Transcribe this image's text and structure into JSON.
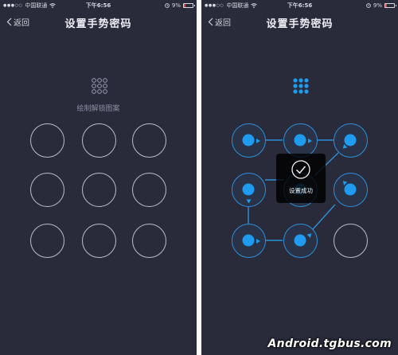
{
  "status_bar": {
    "carrier": "中国联通",
    "time": "下午6:56",
    "battery": "9%"
  },
  "nav": {
    "back_label": "返回",
    "title": "设置手势密码"
  },
  "left_screen": {
    "hint": "绘制解锁图案"
  },
  "right_screen": {
    "toast": "设置成功"
  },
  "watermark": "Android.tgbus.com",
  "colors": {
    "background": "#292b3b",
    "accent": "#1f9bf0",
    "circle_idle": "#b9bccb"
  },
  "icons": [
    "chevron-left-icon",
    "wifi-icon",
    "alarm-icon",
    "battery-icon",
    "grid-dots-icon",
    "checkmark-icon"
  ]
}
